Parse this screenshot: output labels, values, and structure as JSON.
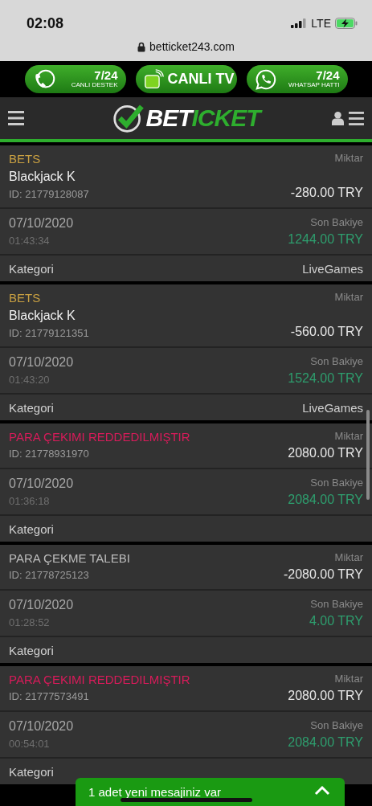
{
  "status_bar": {
    "time": "02:08",
    "network": "LTE",
    "url": "betticket243.com"
  },
  "banners": [
    {
      "kind": "support",
      "top": "7/24",
      "bottom": "CANLI DESTEK"
    },
    {
      "kind": "tv",
      "label": "CANLI TV"
    },
    {
      "kind": "whatsapp",
      "top": "7/24",
      "bottom": "WHATSAP HATTI"
    }
  ],
  "header": {
    "logo_white": "BET",
    "logo_green": "ICKET"
  },
  "transactions": [
    {
      "type": "BETS",
      "color": "#c9a042",
      "name": "Blackjack K",
      "id": "ID: 21779128087",
      "amount_label": "Miktar",
      "amount": "-280.00 TRY",
      "date": "07/10/2020",
      "time": "01:43:34",
      "balance_label": "Son Bakiye",
      "balance": "1244.00 TRY",
      "category_label": "Kategori",
      "category": "LiveGames"
    },
    {
      "type": "BETS",
      "color": "#c9a042",
      "name": "Blackjack K",
      "id": "ID: 21779121351",
      "amount_label": "Miktar",
      "amount": "-560.00 TRY",
      "date": "07/10/2020",
      "time": "01:43:20",
      "balance_label": "Son Bakiye",
      "balance": "1524.00 TRY",
      "category_label": "Kategori",
      "category": "LiveGames"
    },
    {
      "type": "PARA ÇEKIMI REDDEDILMIŞTIR",
      "color": "#d81b5a",
      "id": "ID: 21778931970",
      "amount_label": "Miktar",
      "amount": "2080.00 TRY",
      "date": "07/10/2020",
      "time": "01:36:18",
      "balance_label": "Son Bakiye",
      "balance": "2084.00 TRY",
      "category_label": "Kategori"
    },
    {
      "type": "PARA ÇEKME TALEBI",
      "color": "#bdbdbd",
      "id": "ID: 21778725123",
      "amount_label": "Miktar",
      "amount": "-2080.00 TRY",
      "date": "07/10/2020",
      "time": "01:28:52",
      "balance_label": "Son Bakiye",
      "balance": "4.00 TRY",
      "category_label": "Kategori"
    },
    {
      "type": "PARA ÇEKIMI REDDEDILMIŞTIR",
      "color": "#d81b5a",
      "id": "ID: 21777573491",
      "amount_label": "Miktar",
      "amount": "2080.00 TRY",
      "date": "07/10/2020",
      "time": "00:54:01",
      "balance_label": "Son Bakiye",
      "balance": "2084.00 TRY",
      "category_label": "Kategori"
    }
  ],
  "message_bar": {
    "text": "1 adet yeni mesajiniz var",
    "expanded": false
  }
}
